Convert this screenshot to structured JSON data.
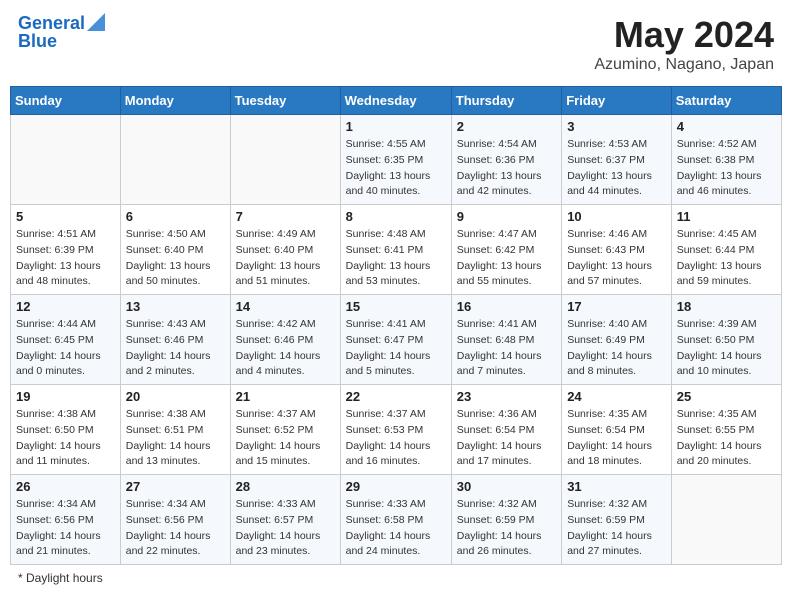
{
  "header": {
    "logo_line1": "General",
    "logo_line2": "Blue",
    "month_year": "May 2024",
    "location": "Azumino, Nagano, Japan"
  },
  "days_of_week": [
    "Sunday",
    "Monday",
    "Tuesday",
    "Wednesday",
    "Thursday",
    "Friday",
    "Saturday"
  ],
  "footer": {
    "daylight_label": "Daylight hours"
  },
  "weeks": [
    [
      {
        "day": "",
        "sunrise": "",
        "sunset": "",
        "daylight": ""
      },
      {
        "day": "",
        "sunrise": "",
        "sunset": "",
        "daylight": ""
      },
      {
        "day": "",
        "sunrise": "",
        "sunset": "",
        "daylight": ""
      },
      {
        "day": "1",
        "sunrise": "Sunrise: 4:55 AM",
        "sunset": "Sunset: 6:35 PM",
        "daylight": "Daylight: 13 hours and 40 minutes."
      },
      {
        "day": "2",
        "sunrise": "Sunrise: 4:54 AM",
        "sunset": "Sunset: 6:36 PM",
        "daylight": "Daylight: 13 hours and 42 minutes."
      },
      {
        "day": "3",
        "sunrise": "Sunrise: 4:53 AM",
        "sunset": "Sunset: 6:37 PM",
        "daylight": "Daylight: 13 hours and 44 minutes."
      },
      {
        "day": "4",
        "sunrise": "Sunrise: 4:52 AM",
        "sunset": "Sunset: 6:38 PM",
        "daylight": "Daylight: 13 hours and 46 minutes."
      }
    ],
    [
      {
        "day": "5",
        "sunrise": "Sunrise: 4:51 AM",
        "sunset": "Sunset: 6:39 PM",
        "daylight": "Daylight: 13 hours and 48 minutes."
      },
      {
        "day": "6",
        "sunrise": "Sunrise: 4:50 AM",
        "sunset": "Sunset: 6:40 PM",
        "daylight": "Daylight: 13 hours and 50 minutes."
      },
      {
        "day": "7",
        "sunrise": "Sunrise: 4:49 AM",
        "sunset": "Sunset: 6:40 PM",
        "daylight": "Daylight: 13 hours and 51 minutes."
      },
      {
        "day": "8",
        "sunrise": "Sunrise: 4:48 AM",
        "sunset": "Sunset: 6:41 PM",
        "daylight": "Daylight: 13 hours and 53 minutes."
      },
      {
        "day": "9",
        "sunrise": "Sunrise: 4:47 AM",
        "sunset": "Sunset: 6:42 PM",
        "daylight": "Daylight: 13 hours and 55 minutes."
      },
      {
        "day": "10",
        "sunrise": "Sunrise: 4:46 AM",
        "sunset": "Sunset: 6:43 PM",
        "daylight": "Daylight: 13 hours and 57 minutes."
      },
      {
        "day": "11",
        "sunrise": "Sunrise: 4:45 AM",
        "sunset": "Sunset: 6:44 PM",
        "daylight": "Daylight: 13 hours and 59 minutes."
      }
    ],
    [
      {
        "day": "12",
        "sunrise": "Sunrise: 4:44 AM",
        "sunset": "Sunset: 6:45 PM",
        "daylight": "Daylight: 14 hours and 0 minutes."
      },
      {
        "day": "13",
        "sunrise": "Sunrise: 4:43 AM",
        "sunset": "Sunset: 6:46 PM",
        "daylight": "Daylight: 14 hours and 2 minutes."
      },
      {
        "day": "14",
        "sunrise": "Sunrise: 4:42 AM",
        "sunset": "Sunset: 6:46 PM",
        "daylight": "Daylight: 14 hours and 4 minutes."
      },
      {
        "day": "15",
        "sunrise": "Sunrise: 4:41 AM",
        "sunset": "Sunset: 6:47 PM",
        "daylight": "Daylight: 14 hours and 5 minutes."
      },
      {
        "day": "16",
        "sunrise": "Sunrise: 4:41 AM",
        "sunset": "Sunset: 6:48 PM",
        "daylight": "Daylight: 14 hours and 7 minutes."
      },
      {
        "day": "17",
        "sunrise": "Sunrise: 4:40 AM",
        "sunset": "Sunset: 6:49 PM",
        "daylight": "Daylight: 14 hours and 8 minutes."
      },
      {
        "day": "18",
        "sunrise": "Sunrise: 4:39 AM",
        "sunset": "Sunset: 6:50 PM",
        "daylight": "Daylight: 14 hours and 10 minutes."
      }
    ],
    [
      {
        "day": "19",
        "sunrise": "Sunrise: 4:38 AM",
        "sunset": "Sunset: 6:50 PM",
        "daylight": "Daylight: 14 hours and 11 minutes."
      },
      {
        "day": "20",
        "sunrise": "Sunrise: 4:38 AM",
        "sunset": "Sunset: 6:51 PM",
        "daylight": "Daylight: 14 hours and 13 minutes."
      },
      {
        "day": "21",
        "sunrise": "Sunrise: 4:37 AM",
        "sunset": "Sunset: 6:52 PM",
        "daylight": "Daylight: 14 hours and 15 minutes."
      },
      {
        "day": "22",
        "sunrise": "Sunrise: 4:37 AM",
        "sunset": "Sunset: 6:53 PM",
        "daylight": "Daylight: 14 hours and 16 minutes."
      },
      {
        "day": "23",
        "sunrise": "Sunrise: 4:36 AM",
        "sunset": "Sunset: 6:54 PM",
        "daylight": "Daylight: 14 hours and 17 minutes."
      },
      {
        "day": "24",
        "sunrise": "Sunrise: 4:35 AM",
        "sunset": "Sunset: 6:54 PM",
        "daylight": "Daylight: 14 hours and 18 minutes."
      },
      {
        "day": "25",
        "sunrise": "Sunrise: 4:35 AM",
        "sunset": "Sunset: 6:55 PM",
        "daylight": "Daylight: 14 hours and 20 minutes."
      }
    ],
    [
      {
        "day": "26",
        "sunrise": "Sunrise: 4:34 AM",
        "sunset": "Sunset: 6:56 PM",
        "daylight": "Daylight: 14 hours and 21 minutes."
      },
      {
        "day": "27",
        "sunrise": "Sunrise: 4:34 AM",
        "sunset": "Sunset: 6:56 PM",
        "daylight": "Daylight: 14 hours and 22 minutes."
      },
      {
        "day": "28",
        "sunrise": "Sunrise: 4:33 AM",
        "sunset": "Sunset: 6:57 PM",
        "daylight": "Daylight: 14 hours and 23 minutes."
      },
      {
        "day": "29",
        "sunrise": "Sunrise: 4:33 AM",
        "sunset": "Sunset: 6:58 PM",
        "daylight": "Daylight: 14 hours and 24 minutes."
      },
      {
        "day": "30",
        "sunrise": "Sunrise: 4:32 AM",
        "sunset": "Sunset: 6:59 PM",
        "daylight": "Daylight: 14 hours and 26 minutes."
      },
      {
        "day": "31",
        "sunrise": "Sunrise: 4:32 AM",
        "sunset": "Sunset: 6:59 PM",
        "daylight": "Daylight: 14 hours and 27 minutes."
      },
      {
        "day": "",
        "sunrise": "",
        "sunset": "",
        "daylight": ""
      }
    ]
  ]
}
